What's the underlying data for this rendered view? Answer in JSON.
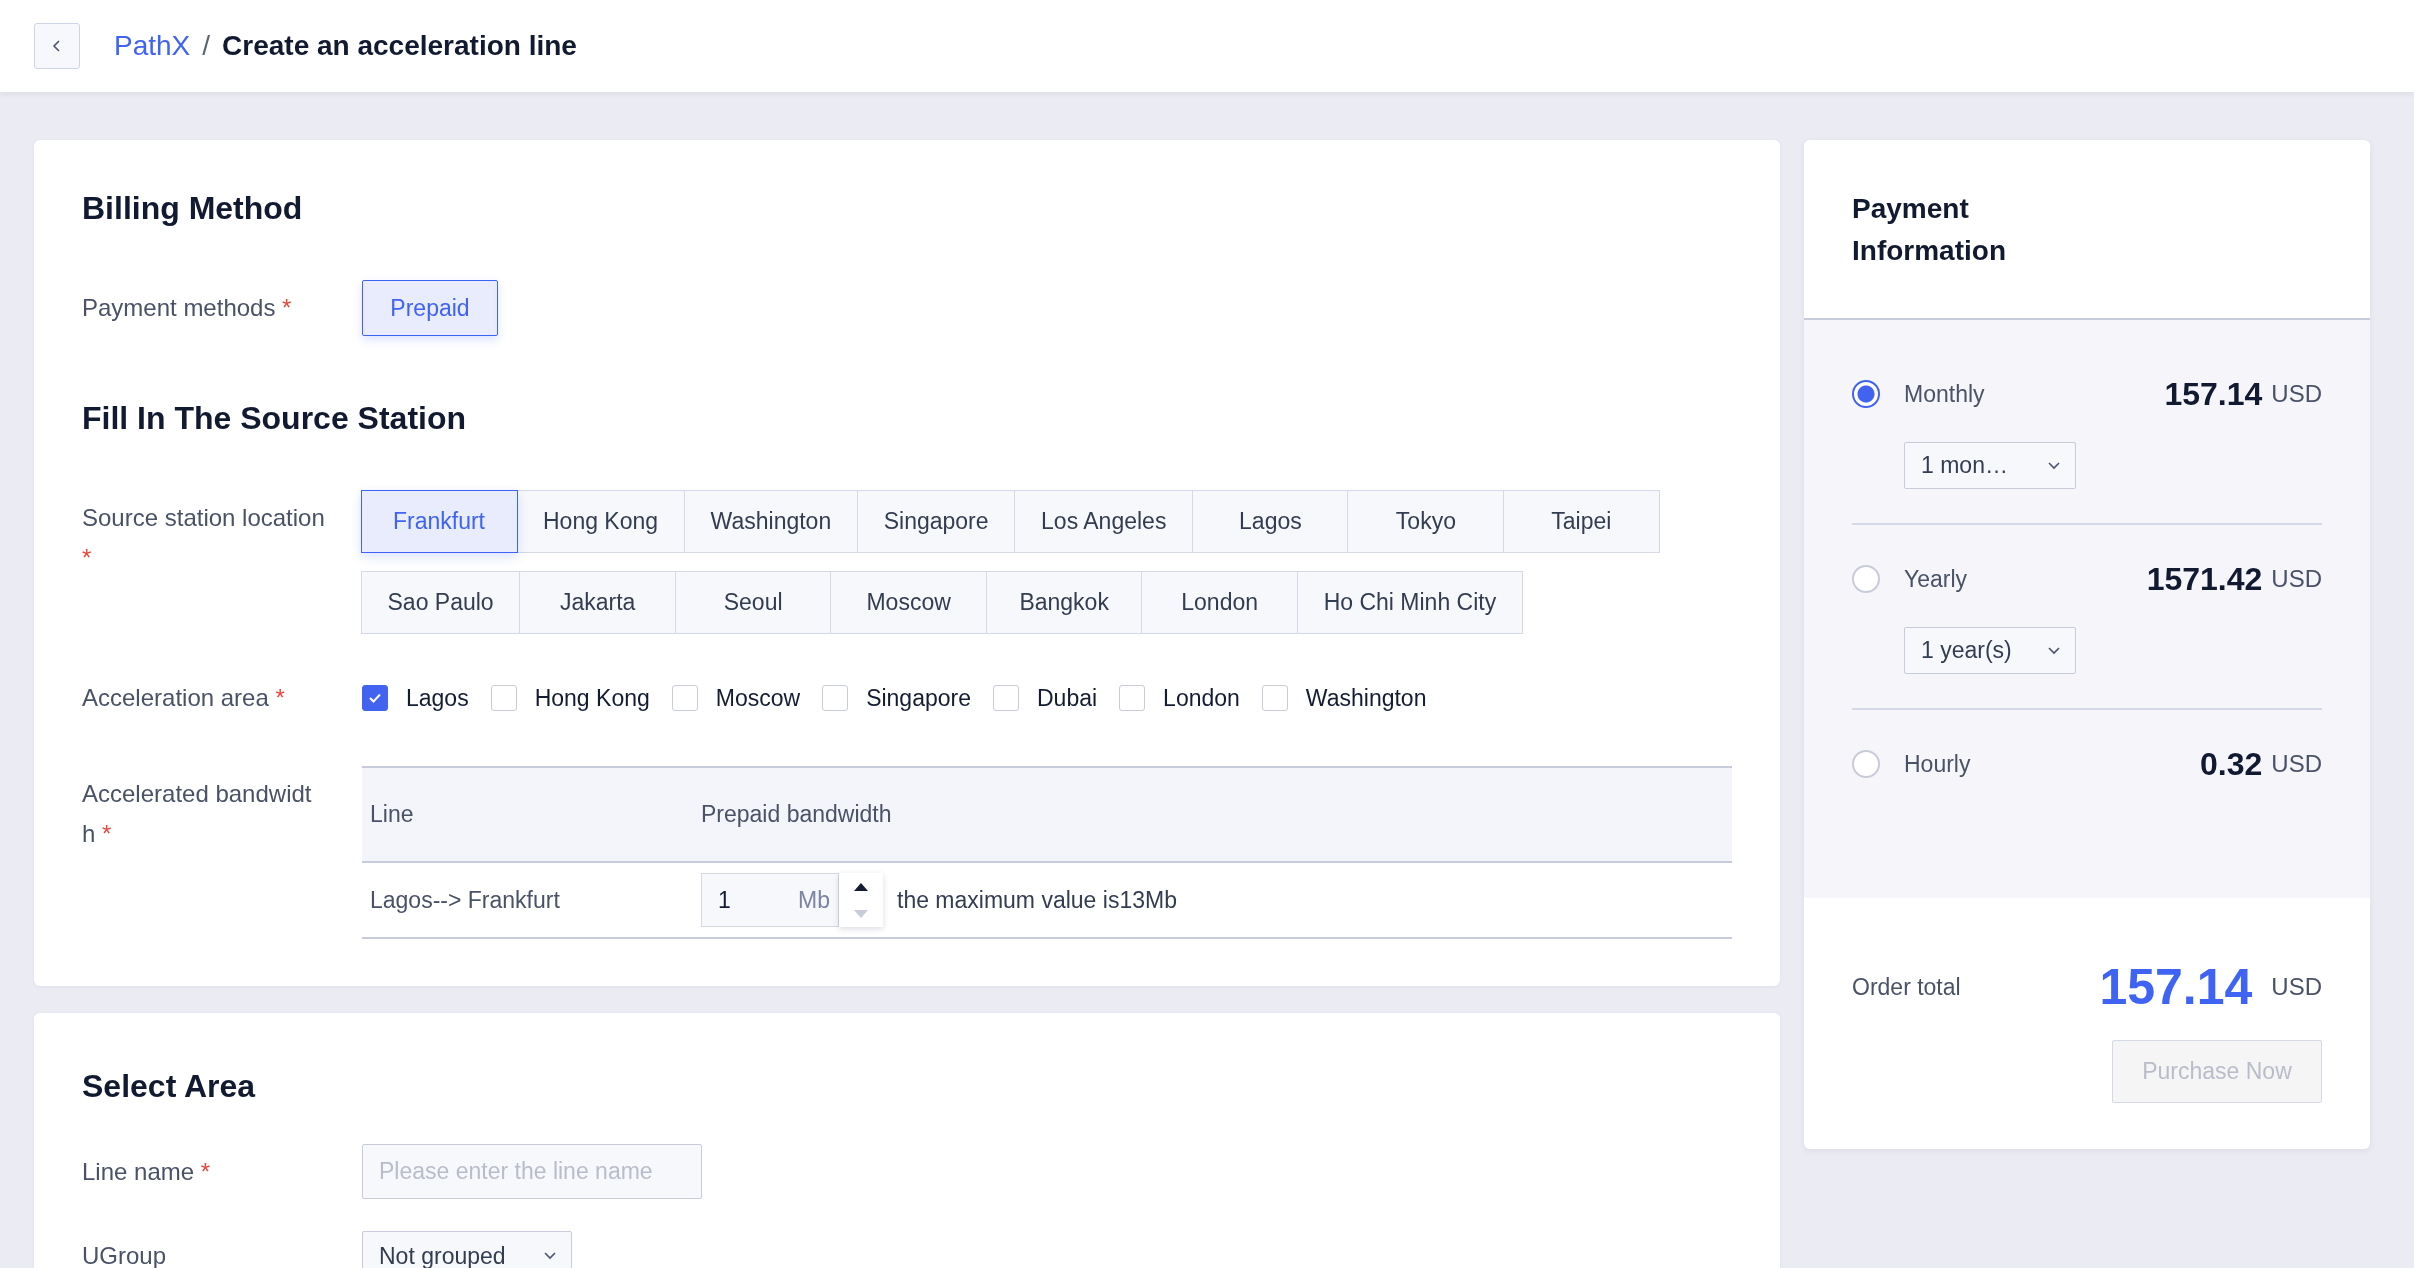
{
  "required_symbol": "*",
  "header": {
    "breadcrumb": [
      {
        "text": "PathX",
        "kind": "link"
      },
      {
        "text": "Create an acceleration line",
        "kind": "current"
      }
    ],
    "separator": "/"
  },
  "billing": {
    "title": "Billing Method",
    "payment_methods": {
      "label": "Payment methods",
      "required": true,
      "options": [
        {
          "label": "Prepaid",
          "selected": true
        }
      ]
    }
  },
  "source": {
    "title": "Fill In The Source Station",
    "location": {
      "label": "Source station location",
      "required": true,
      "rows": [
        [
          {
            "label": "Frankfurt",
            "selected": true
          },
          {
            "label": "Hong Kong",
            "selected": false
          },
          {
            "label": "Washington",
            "selected": false
          },
          {
            "label": "Singapore",
            "selected": false
          },
          {
            "label": "Los Angeles",
            "selected": false
          },
          {
            "label": "Lagos",
            "selected": false
          },
          {
            "label": "Tokyo",
            "selected": false
          },
          {
            "label": "Taipei",
            "selected": false
          }
        ],
        [
          {
            "label": "Sao Paulo",
            "selected": false
          },
          {
            "label": "Jakarta",
            "selected": false
          },
          {
            "label": "Seoul",
            "selected": false
          },
          {
            "label": "Moscow",
            "selected": false
          },
          {
            "label": "Bangkok",
            "selected": false
          },
          {
            "label": "London",
            "selected": false
          },
          {
            "label": "Ho Chi Minh City",
            "selected": false
          }
        ]
      ]
    },
    "acceleration_area": {
      "label": "Acceleration area",
      "required": true,
      "options": [
        {
          "label": "Lagos",
          "checked": true
        },
        {
          "label": "Hong Kong",
          "checked": false
        },
        {
          "label": "Moscow",
          "checked": false
        },
        {
          "label": "Singapore",
          "checked": false
        },
        {
          "label": "Dubai",
          "checked": false
        },
        {
          "label": "London",
          "checked": false
        },
        {
          "label": "Washington",
          "checked": false
        }
      ]
    },
    "bandwidth": {
      "label": "Accelerated bandwidth",
      "required": true,
      "columns": [
        "Line",
        "Prepaid bandwidth"
      ],
      "rows": [
        {
          "line": "Lagos--> Frankfurt",
          "value": "1",
          "unit": "Mb",
          "hint": "the maximum value is13Mb"
        }
      ]
    }
  },
  "select_area": {
    "title": "Select Area",
    "line_name": {
      "label": "Line name",
      "required": true,
      "placeholder": "Please enter the line name"
    },
    "ugroup": {
      "label": "UGroup",
      "value": "Not grouped"
    }
  },
  "payment": {
    "title": "Payment Information",
    "plans": [
      {
        "label": "Monthly",
        "selected": true,
        "price": "157.14",
        "currency": "USD",
        "period": "1 mon…"
      },
      {
        "label": "Yearly",
        "selected": false,
        "price": "1571.42",
        "currency": "USD",
        "period": "1 year(s)"
      },
      {
        "label": "Hourly",
        "selected": false,
        "price": "0.32",
        "currency": "USD"
      }
    ],
    "order_total": {
      "label": "Order total",
      "amount": "157.14",
      "currency": "USD"
    },
    "purchase": {
      "label": "Purchase Now",
      "disabled": true
    }
  }
}
